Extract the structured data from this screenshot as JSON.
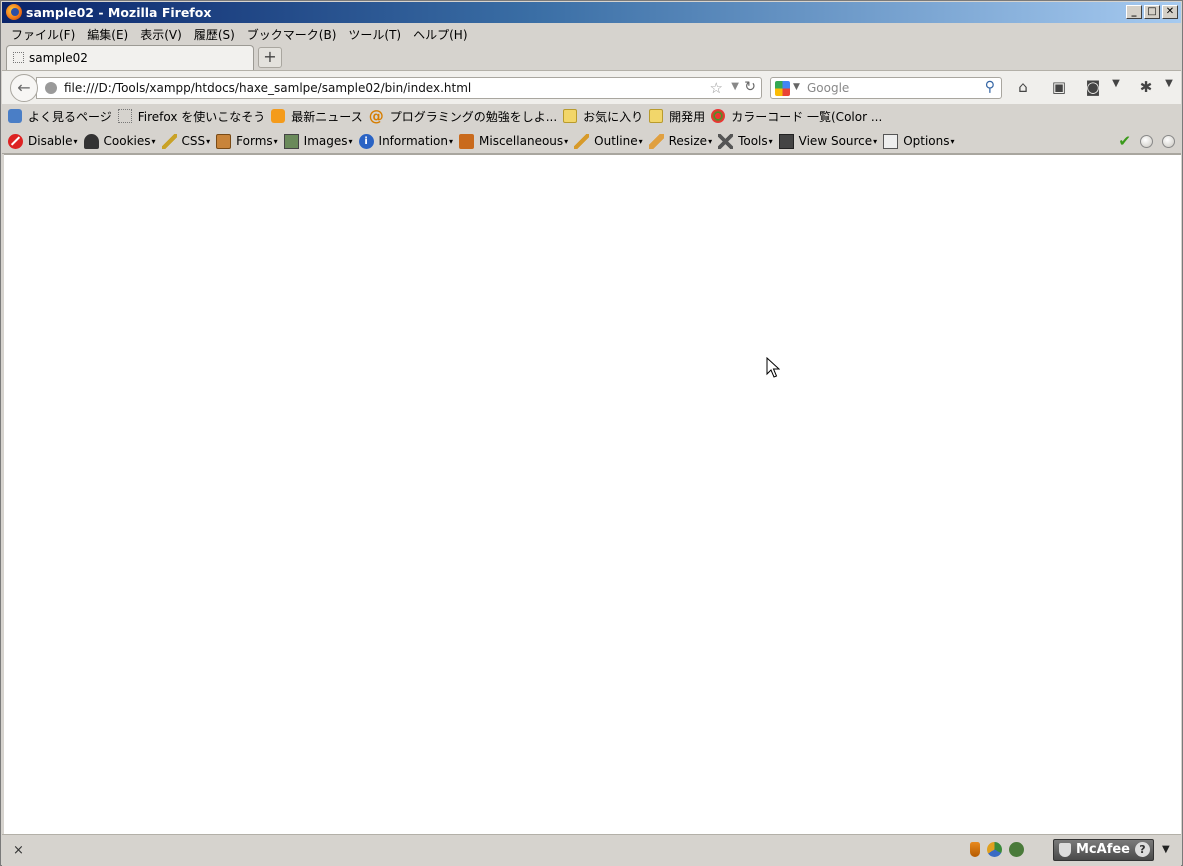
{
  "window": {
    "title": "sample02 - Mozilla Firefox",
    "controls": {
      "minimize": "_",
      "maximize": "□",
      "close": "✕"
    }
  },
  "menubar": {
    "items": [
      "ファイル(F)",
      "編集(E)",
      "表示(V)",
      "履歴(S)",
      "ブックマーク(B)",
      "ツール(T)",
      "ヘルプ(H)"
    ]
  },
  "tabs": {
    "active_label": "sample02",
    "new_tab_label": "+"
  },
  "navigation": {
    "back_glyph": "←",
    "url": "file:///D:/Tools/xampp/htdocs/haxe_samlpe/sample02/bin/index.html",
    "search": {
      "placeholder": "Google"
    }
  },
  "bookmarks": {
    "items": [
      {
        "label": "よく見るページ",
        "icon": "most-visited-icon"
      },
      {
        "label": "Firefox を使いこなそう",
        "icon": "page-icon"
      },
      {
        "label": "最新ニュース",
        "icon": "rss-icon"
      },
      {
        "label": "プログラミングの勉強をしよ...",
        "icon": "at-icon"
      },
      {
        "label": "お気に入り",
        "icon": "folder-icon"
      },
      {
        "label": "開発用",
        "icon": "folder-icon"
      },
      {
        "label": "カラーコード 一覧(Color ...",
        "icon": "color-icon"
      }
    ]
  },
  "devtoolbar": {
    "items": [
      {
        "label": "Disable",
        "icon": "disable-icon"
      },
      {
        "label": "Cookies",
        "icon": "cookies-icon"
      },
      {
        "label": "CSS",
        "icon": "css-icon"
      },
      {
        "label": "Forms",
        "icon": "forms-icon"
      },
      {
        "label": "Images",
        "icon": "images-icon"
      },
      {
        "label": "Information",
        "icon": "information-icon"
      },
      {
        "label": "Miscellaneous",
        "icon": "miscellaneous-icon"
      },
      {
        "label": "Outline",
        "icon": "outline-icon"
      },
      {
        "label": "Resize",
        "icon": "resize-icon"
      },
      {
        "label": "Tools",
        "icon": "tools-icon"
      },
      {
        "label": "View Source",
        "icon": "view-source-icon"
      },
      {
        "label": "Options",
        "icon": "options-icon"
      }
    ]
  },
  "statusbar": {
    "close_glyph": "×",
    "mcafee_label": "McAfee",
    "help_glyph": "?"
  }
}
